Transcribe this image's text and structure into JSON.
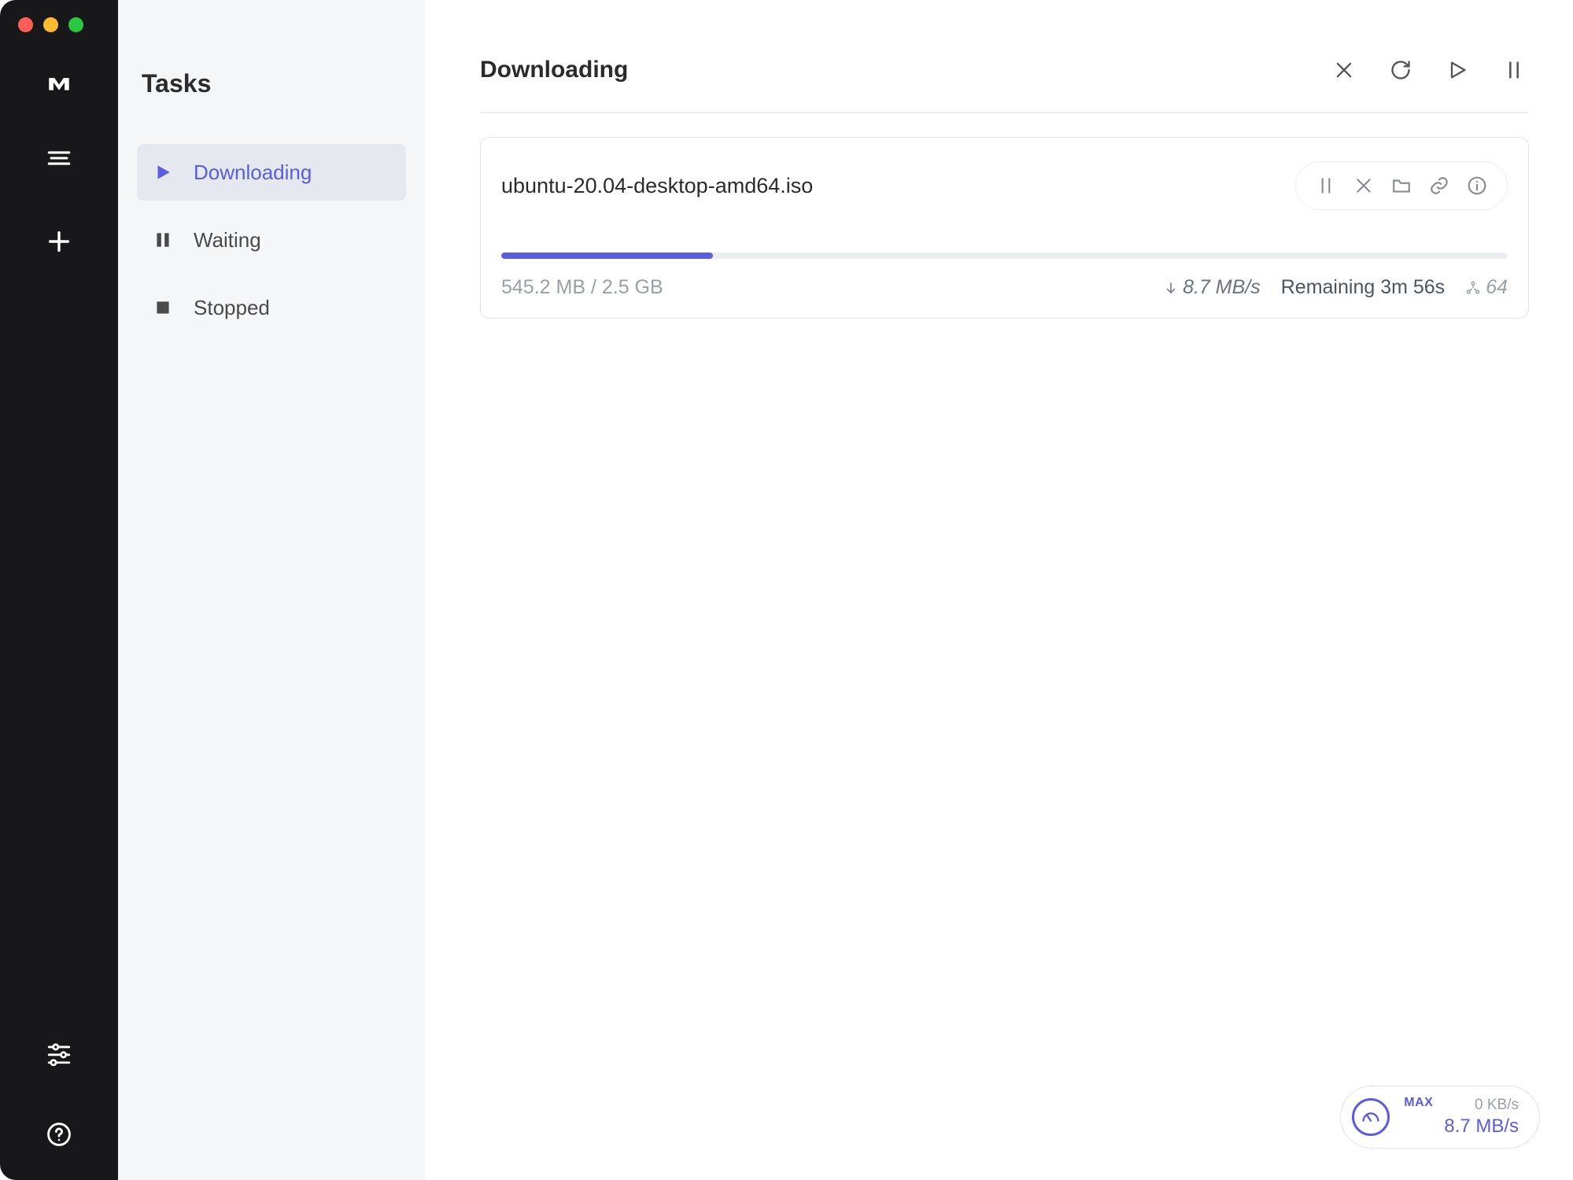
{
  "sidebar": {
    "title": "Tasks",
    "items": [
      {
        "label": "Downloading"
      },
      {
        "label": "Waiting"
      },
      {
        "label": "Stopped"
      }
    ]
  },
  "main": {
    "title": "Downloading"
  },
  "task": {
    "filename": "ubuntu-20.04-desktop-amd64.iso",
    "size_text": "545.2 MB / 2.5 GB",
    "progress_percent": 21,
    "speed": "8.7 MB/s",
    "remaining": "Remaining 3m 56s",
    "peers": "64"
  },
  "speed_widget": {
    "label": "MAX",
    "upload": "0 KB/s",
    "download": "8.7 MB/s"
  }
}
